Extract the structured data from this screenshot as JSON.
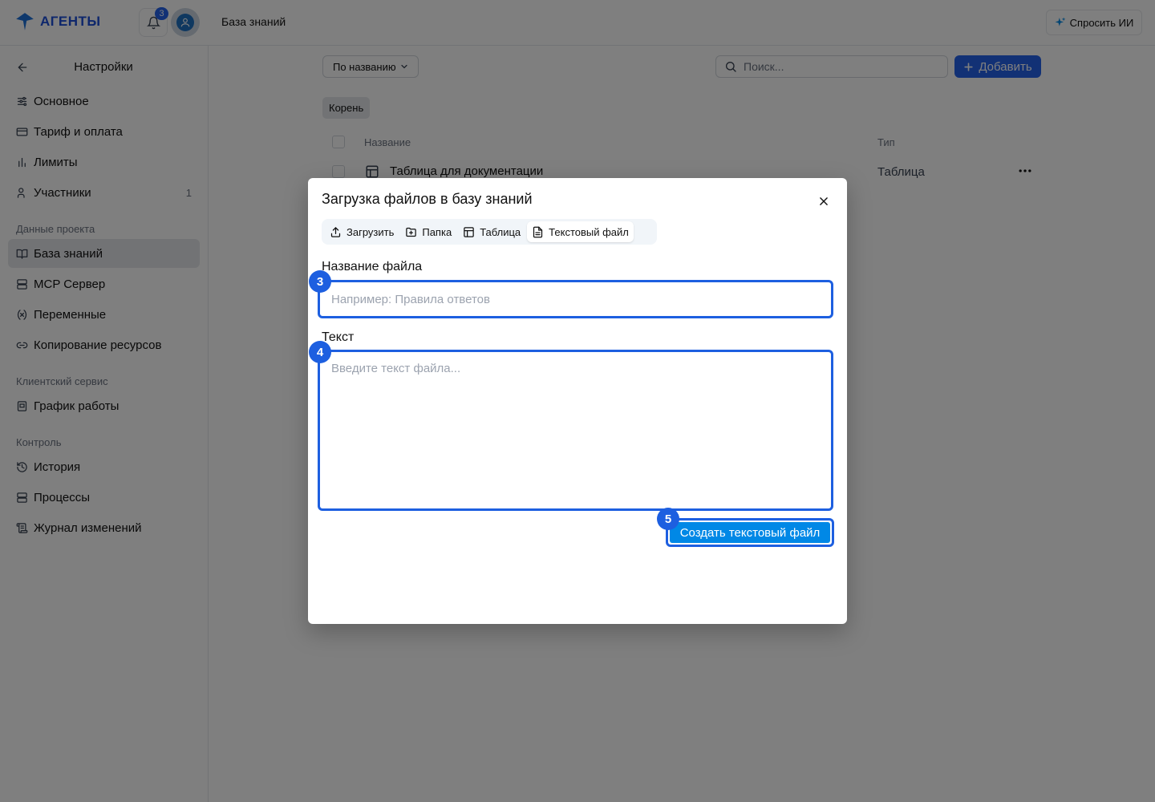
{
  "app": {
    "logo_text": "АГЕНТЫ",
    "notifications_count": "3",
    "page_title": "База знаний",
    "ask_ai_label": "Спросить ИИ"
  },
  "colors": {
    "accent": "#2563eb",
    "highlight": "#1d5fe0",
    "submit": "#0088e6"
  },
  "sidebar": {
    "title": "Настройки",
    "items": [
      {
        "label": "Основное",
        "icon": "sliders-icon"
      },
      {
        "label": "Тариф и оплата",
        "icon": "credit-card-icon"
      },
      {
        "label": "Лимиты",
        "icon": "bar-chart-icon"
      },
      {
        "label": "Участники",
        "icon": "users-icon",
        "count": "1"
      }
    ],
    "sections": [
      {
        "title": "Данные проекта",
        "items": [
          {
            "label": "База знаний",
            "icon": "book-icon",
            "active": true
          },
          {
            "label": "MCP Сервер",
            "icon": "server-icon"
          },
          {
            "label": "Переменные",
            "icon": "variable-icon"
          },
          {
            "label": "Копирование ресурсов",
            "icon": "link-icon"
          }
        ]
      },
      {
        "title": "Клиентский сервис",
        "items": [
          {
            "label": "График работы",
            "icon": "calendar-icon"
          }
        ]
      },
      {
        "title": "Контроль",
        "items": [
          {
            "label": "История",
            "icon": "history-icon"
          },
          {
            "label": "Процессы",
            "icon": "server-icon"
          },
          {
            "label": "Журнал изменений",
            "icon": "log-icon"
          }
        ]
      }
    ]
  },
  "toolbar": {
    "sort_label": "По названию",
    "search_placeholder": "Поиск...",
    "add_label": "Добавить"
  },
  "breadcrumb": {
    "root": "Корень"
  },
  "table": {
    "columns": [
      "Название",
      "Тип"
    ],
    "rows": [
      {
        "name": "Таблица для документации",
        "type": "Таблица"
      }
    ]
  },
  "modal": {
    "title": "Загрузка файлов в базу знаний",
    "tabs": [
      {
        "label": "Загрузить",
        "icon": "upload-icon"
      },
      {
        "label": "Папка",
        "icon": "folder-plus-icon"
      },
      {
        "label": "Таблица",
        "icon": "table-icon"
      },
      {
        "label": "Текстовый файл",
        "icon": "file-text-icon",
        "active": true
      }
    ],
    "name_label": "Название файла",
    "name_placeholder": "Например: Правила ответов",
    "name_value": "",
    "text_label": "Текст",
    "text_placeholder": "Введите текст файла...",
    "text_value": "",
    "submit_label": "Создать текстовый файл"
  },
  "markers": [
    "3",
    "4",
    "5"
  ]
}
